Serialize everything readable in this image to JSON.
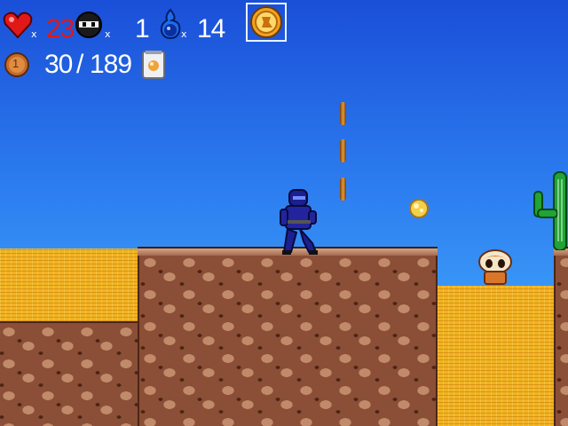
{
  "hud": {
    "lives": "23",
    "lives_x": "x",
    "ninja_count": "1",
    "ninja_x": "x",
    "spirit_count": "14",
    "spirit_x": "x",
    "coins_collected": "30",
    "coins_separator": "/",
    "coins_total": "189",
    "coin_icon_label": "1",
    "selected_item": "power-coin"
  },
  "colors": {
    "lives_text": "#e01818",
    "hud_text": "#ffffff",
    "sky_top": "#1a4fd8",
    "sky_bottom": "#49b6ff",
    "sand": "#f0b323",
    "rock": "#8a4f36"
  },
  "icons": {
    "lives": "heart-icon",
    "ninja": "ninja-head-icon",
    "spirit": "blue-flame-icon",
    "item": "gold-coin-item-icon",
    "coin": "bronze-coin-icon",
    "scroll": "scroll-bag-icon"
  }
}
